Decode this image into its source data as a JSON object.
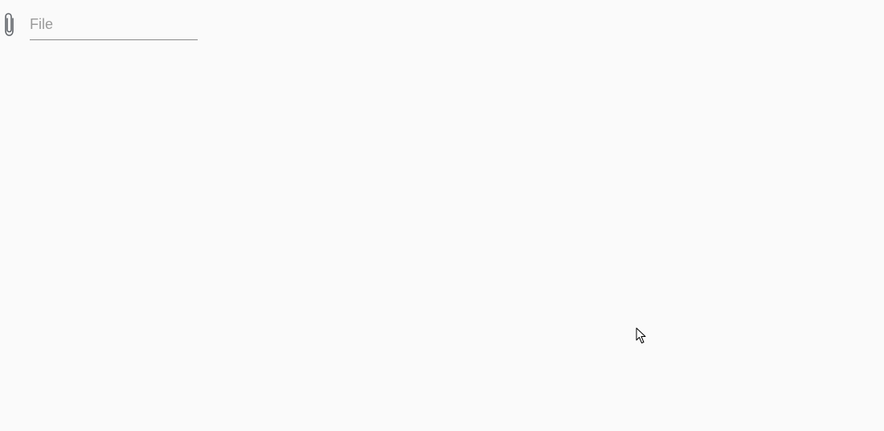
{
  "file_field": {
    "placeholder": "File",
    "value": "",
    "icon": "paperclip-icon"
  },
  "cursor": {
    "icon": "mouse-pointer-icon"
  }
}
